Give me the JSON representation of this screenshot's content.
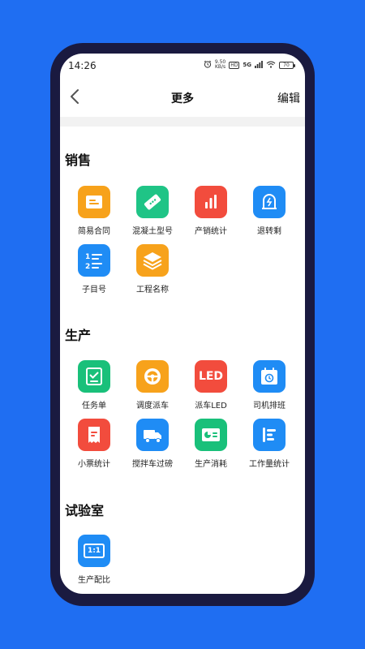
{
  "status_bar": {
    "time": "14:26",
    "net_speed_value": "9.50",
    "net_speed_unit": "KB/s",
    "hd_label": "HD",
    "network_label": "5G",
    "battery_level": "70"
  },
  "header": {
    "title": "更多",
    "edit_label": "编辑"
  },
  "sections": [
    {
      "title": "销售",
      "items": [
        {
          "label": "简易合同",
          "color": "#f7a21b",
          "icon": "contract-icon"
        },
        {
          "label": "混凝土型号",
          "color": "#1fc486",
          "icon": "ticket-icon"
        },
        {
          "label": "产销统计",
          "color": "#f24c3d",
          "icon": "bar-chart-icon"
        },
        {
          "label": "退转剩",
          "color": "#1f8cf5",
          "icon": "return-icon"
        },
        {
          "label": "子目号",
          "color": "#1f8cf5",
          "icon": "numbered-list-icon"
        },
        {
          "label": "工程名称",
          "color": "#f7a21b",
          "icon": "layers-icon"
        }
      ]
    },
    {
      "title": "生产",
      "items": [
        {
          "label": "任务单",
          "color": "#19c07a",
          "icon": "task-list-icon"
        },
        {
          "label": "调度派车",
          "color": "#f7a21b",
          "icon": "steering-wheel-icon"
        },
        {
          "label": "派车LED",
          "color": "#f24c3d",
          "icon": "led-icon",
          "icon_text": "LED"
        },
        {
          "label": "司机排班",
          "color": "#1f8cf5",
          "icon": "calendar-icon"
        },
        {
          "label": "小票统计",
          "color": "#f24c3d",
          "icon": "receipt-icon"
        },
        {
          "label": "搅拌车过磅",
          "color": "#1f8cf5",
          "icon": "truck-icon"
        },
        {
          "label": "生产消耗",
          "color": "#19c07a",
          "icon": "pie-card-icon"
        },
        {
          "label": "工作量统计",
          "color": "#1f8cf5",
          "icon": "workload-icon"
        }
      ]
    },
    {
      "title": "试验室",
      "items": [
        {
          "label": "生产配比",
          "color": "#1f8cf5",
          "icon": "ratio-icon",
          "icon_text": "1:1"
        }
      ]
    }
  ]
}
